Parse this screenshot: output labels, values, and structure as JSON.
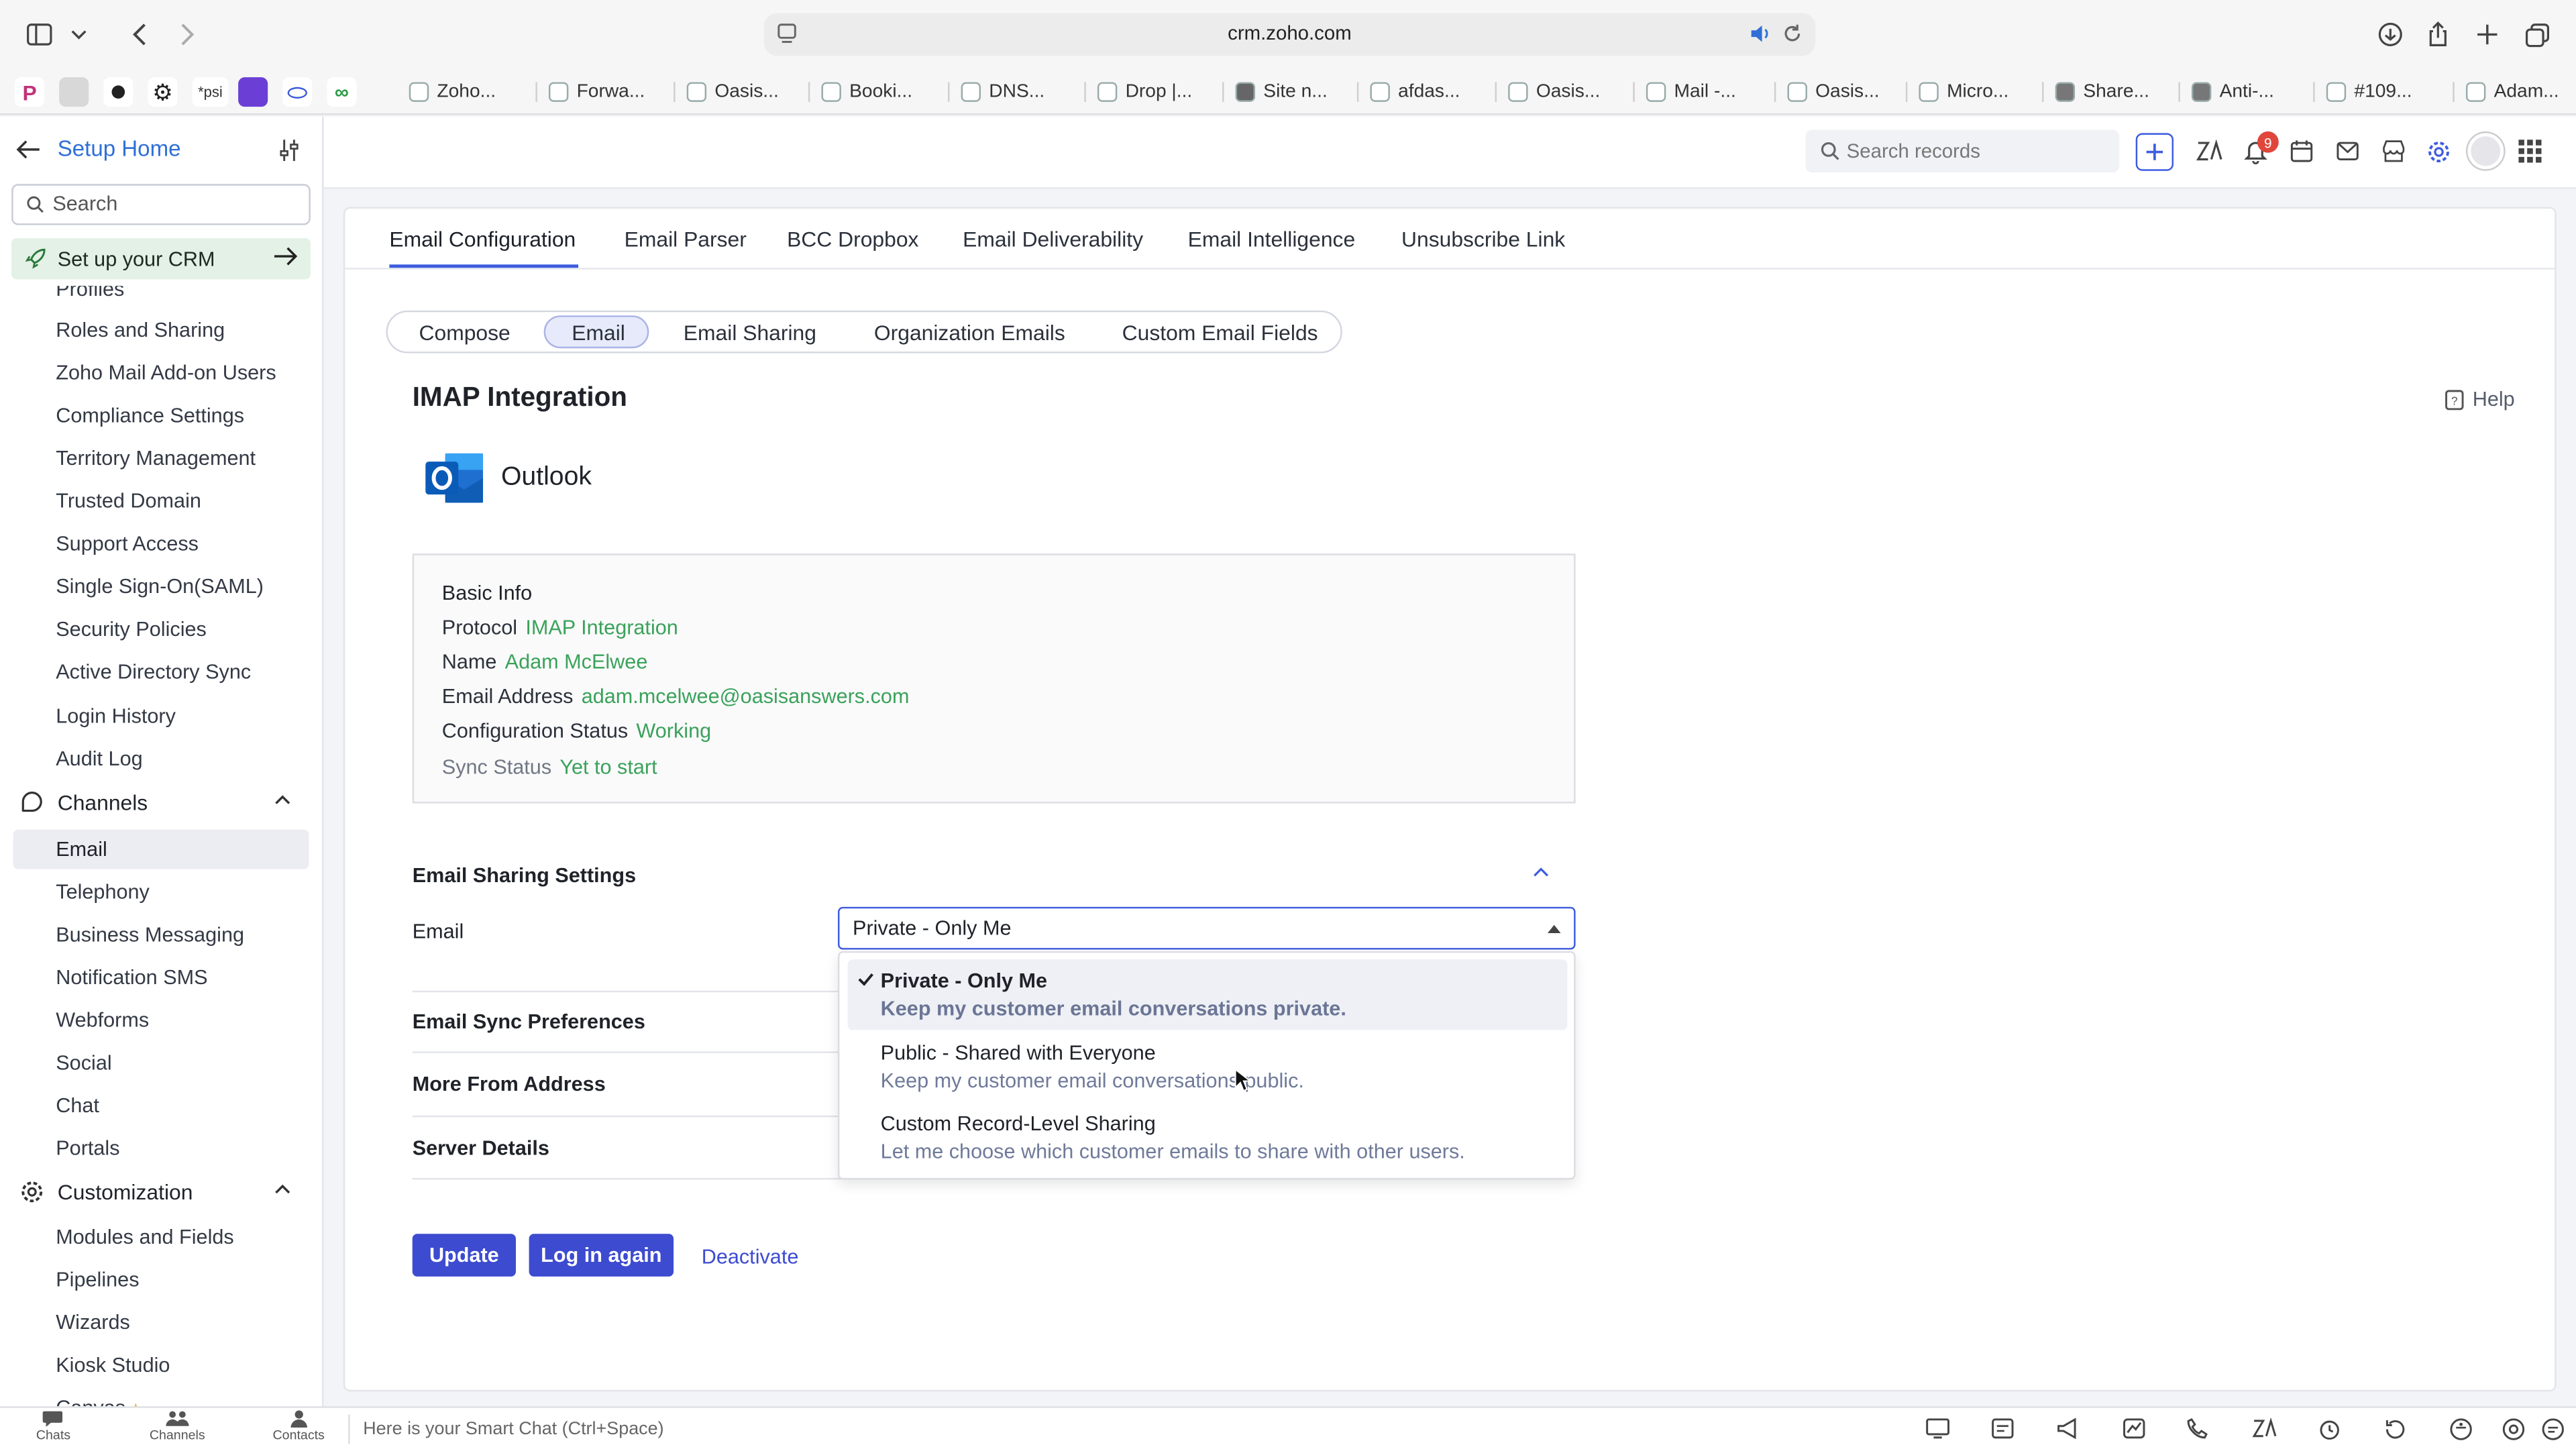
{
  "browser": {
    "url": "crm.zoho.com",
    "tabs": [
      "Zoho...",
      "Forwa...",
      "Oasis...",
      "Booki...",
      "DNS...",
      "Drop |...",
      "Site n...",
      "afdas...",
      "Oasis...",
      "Mail -...",
      "Oasis...",
      "Micro...",
      "Share...",
      "Anti-...",
      "#109...",
      "Adam..."
    ],
    "pinned_text": "*psi"
  },
  "crm_top": {
    "search_placeholder": "Search records",
    "notification_count": "9"
  },
  "sidebar": {
    "title": "Setup Home",
    "search_placeholder": "Search",
    "setup_crm": "Set up your CRM",
    "partial_top": "Profiles",
    "items_security": [
      "Roles and Sharing",
      "Zoho Mail Add-on Users",
      "Compliance Settings",
      "Territory Management",
      "Trusted Domain",
      "Support Access",
      "Single Sign-On(SAML)",
      "Security Policies",
      "Active Directory Sync",
      "Login History",
      "Audit Log"
    ],
    "channels_label": "Channels",
    "items_channels": [
      "Email",
      "Telephony",
      "Business Messaging",
      "Notification SMS",
      "Webforms",
      "Social",
      "Chat",
      "Portals"
    ],
    "customization_label": "Customization",
    "items_customization": [
      "Modules and Fields",
      "Pipelines",
      "Wizards",
      "Kiosk Studio"
    ],
    "partial_bottom": "Canvas"
  },
  "tabs": [
    "Email Configuration",
    "Email Parser",
    "BCC Dropbox",
    "Email Deliverability",
    "Email Intelligence",
    "Unsubscribe Link"
  ],
  "subtabs": [
    "Compose",
    "Email",
    "Email Sharing",
    "Organization Emails",
    "Custom Email Fields"
  ],
  "page": {
    "title": "IMAP Integration",
    "help": "Help",
    "provider": "Outlook"
  },
  "basic_info": {
    "title": "Basic Info",
    "protocol_label": "Protocol",
    "protocol_value": "IMAP Integration",
    "name_label": "Name",
    "name_value": "Adam McElwee",
    "email_label": "Email Address",
    "email_value": "adam.mcelwee@oasisanswers.com",
    "config_label": "Configuration Status",
    "config_value": "Working",
    "sync_label": "Sync Status",
    "sync_value": "Yet to start"
  },
  "sharing": {
    "title": "Email Sharing Settings",
    "field_label": "Email",
    "selected": "Private - Only Me",
    "options": [
      {
        "title": "Private - Only Me",
        "desc": "Keep my customer email conversations private."
      },
      {
        "title": "Public - Shared with Everyone",
        "desc": "Keep my customer email conversations public."
      },
      {
        "title": "Custom Record-Level Sharing",
        "desc": "Let me choose which customer emails to share with other users."
      }
    ]
  },
  "sections": [
    "Email Sync Preferences",
    "More From Address",
    "Server Details"
  ],
  "buttons": {
    "update": "Update",
    "relogin": "Log in again",
    "deactivate": "Deactivate"
  },
  "bottom_bar": {
    "chats": "Chats",
    "channels": "Channels",
    "contacts": "Contacts",
    "smart_chat": "Here is your Smart Chat (Ctrl+Space)"
  },
  "colors": {
    "accent": "#3d4bd0",
    "value_green": "#3aa25a",
    "link_blue": "#2f6fd6"
  }
}
